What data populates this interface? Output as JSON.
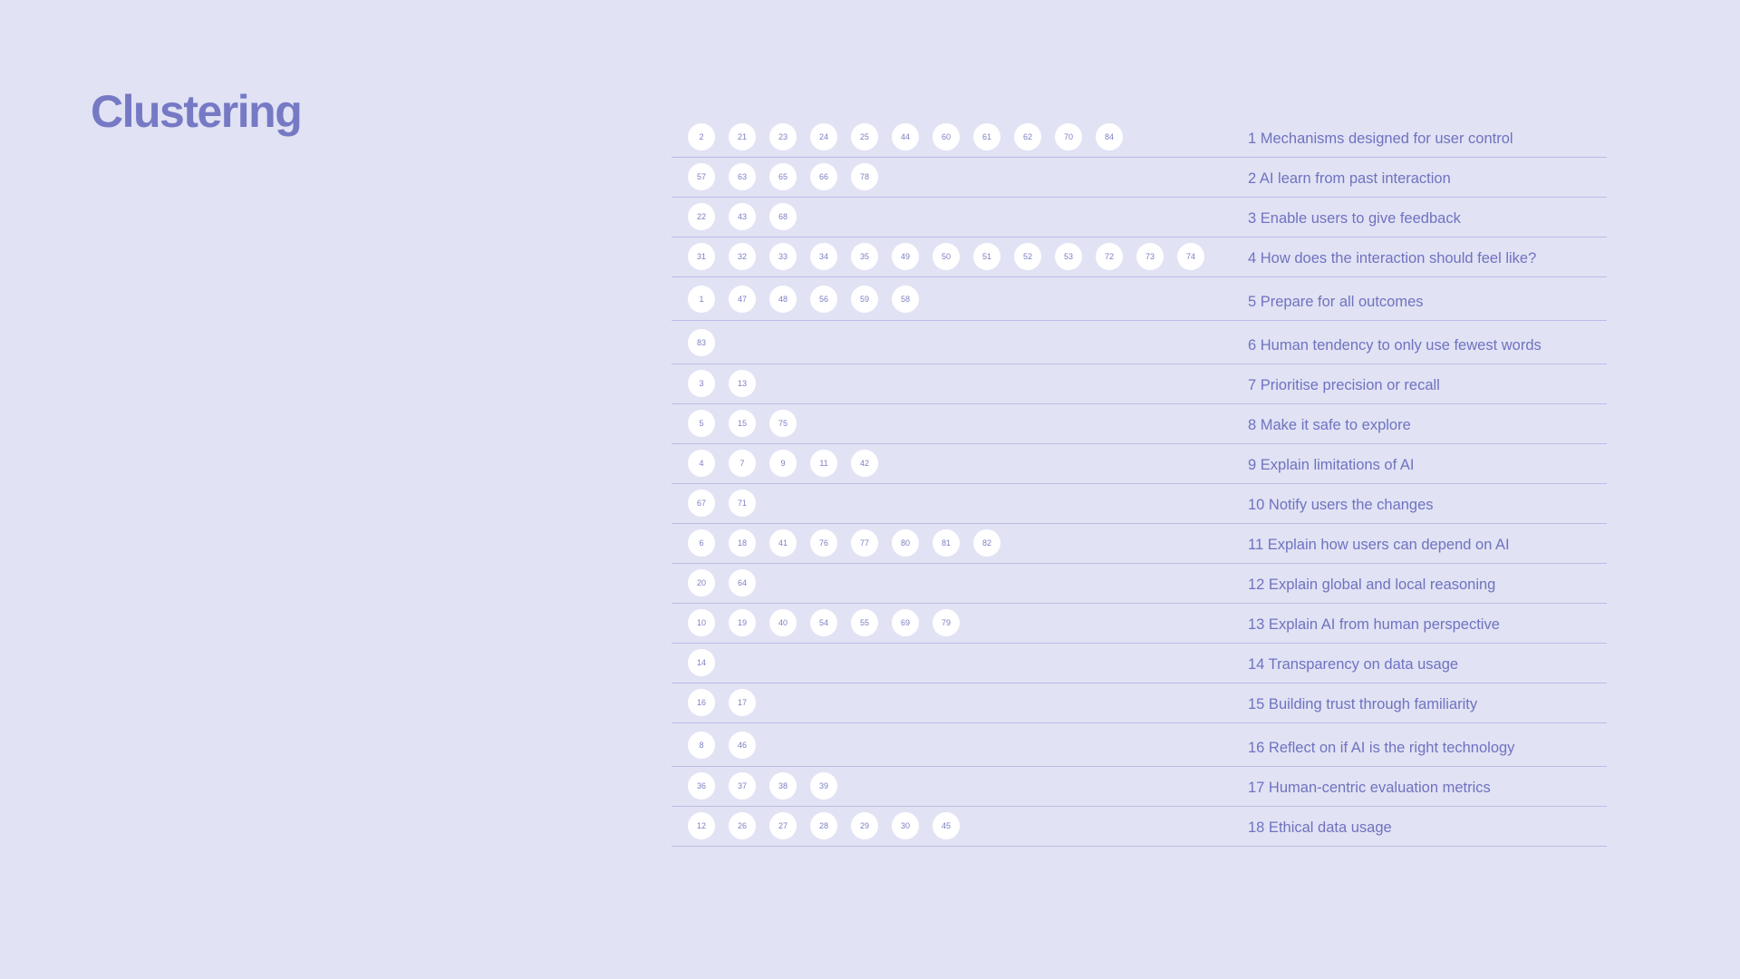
{
  "title": "Clustering",
  "clusters": [
    {
      "label": "1 Mechanisms designed for user control",
      "items": [
        "2",
        "21",
        "23",
        "24",
        "25",
        "44",
        "60",
        "61",
        "62",
        "70",
        "84"
      ]
    },
    {
      "label": "2 AI learn from past interaction",
      "items": [
        "57",
        "63",
        "65",
        "66",
        "78"
      ]
    },
    {
      "label": "3 Enable users to give feedback",
      "items": [
        "22",
        "43",
        "68"
      ]
    },
    {
      "label": "4 How does the interaction should feel like?",
      "items": [
        "31",
        "32",
        "33",
        "34",
        "35",
        "49",
        "50",
        "51",
        "52",
        "53",
        "72",
        "73",
        "74"
      ]
    },
    {
      "label": "5 Prepare for all outcomes",
      "items": [
        "1",
        "47",
        "48",
        "56",
        "59",
        "58"
      ]
    },
    {
      "label": "6 Human tendency to only use fewest words",
      "items": [
        "83"
      ]
    },
    {
      "label": "7 Prioritise precision or recall",
      "items": [
        "3",
        "13"
      ]
    },
    {
      "label": "8 Make it safe to explore",
      "items": [
        "5",
        "15",
        "75"
      ]
    },
    {
      "label": "9 Explain limitations of AI",
      "items": [
        "4",
        "7",
        "9",
        "11",
        "42"
      ]
    },
    {
      "label": "10 Notify users the changes",
      "items": [
        "67",
        "71"
      ]
    },
    {
      "label": "11 Explain how users can depend on AI",
      "items": [
        "6",
        "18",
        "41",
        "76",
        "77",
        "80",
        "81",
        "82"
      ]
    },
    {
      "label": "12 Explain global and local reasoning",
      "items": [
        "20",
        "64"
      ]
    },
    {
      "label": "13 Explain AI from human perspective",
      "items": [
        "10",
        "19",
        "40",
        "54",
        "55",
        "69",
        "79"
      ]
    },
    {
      "label": "14 Transparency on data usage",
      "items": [
        "14"
      ]
    },
    {
      "label": "15 Building trust through familiarity",
      "items": [
        "16",
        "17"
      ]
    },
    {
      "label": "16 Reflect on if AI is the right technology",
      "items": [
        "8",
        "46"
      ]
    },
    {
      "label": "17 Human-centric evaluation metrics",
      "items": [
        "36",
        "37",
        "38",
        "39"
      ]
    },
    {
      "label": "18 Ethical data usage",
      "items": [
        "12",
        "26",
        "27",
        "28",
        "29",
        "30",
        "45"
      ]
    }
  ]
}
